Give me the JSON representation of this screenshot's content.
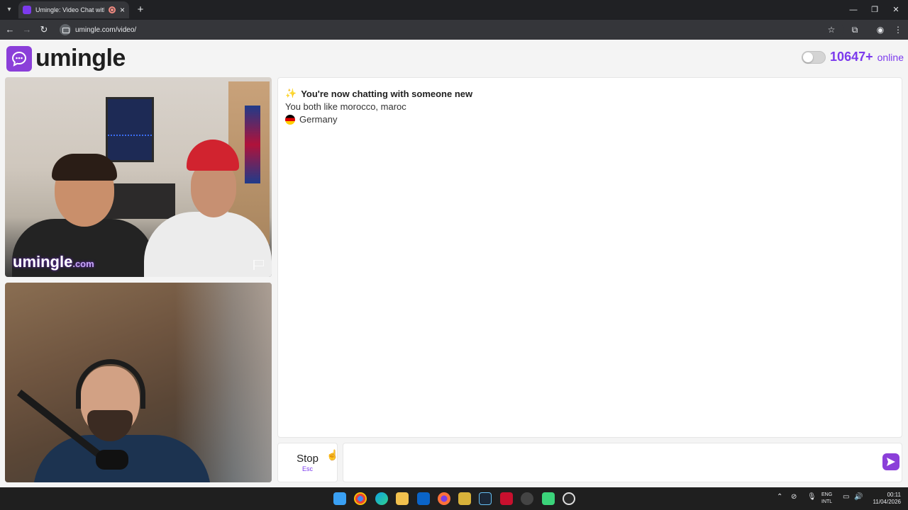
{
  "browser": {
    "tab_title": "Umingle: Video Chat with S",
    "url": "umingle.com/video/",
    "tab_list_icon": "chevron-down-icon",
    "new_tab_glyph": "+",
    "close_glyph": "×"
  },
  "header": {
    "logo_text": "umingle",
    "online_count": "10647+",
    "online_label": "online",
    "theme_toggle_on": false
  },
  "video": {
    "watermark": "umingle",
    "watermark_suffix": ".com"
  },
  "chat": {
    "title": "You're now chatting with someone new",
    "shared_interests": "You both like morocco, maroc",
    "country": "Germany"
  },
  "controls": {
    "stop_label": "Stop",
    "stop_shortcut": "Esc",
    "message_placeholder": ""
  },
  "taskbar": {
    "lang_line1": "ENG",
    "lang_line2": "INTL",
    "time": "00:11",
    "date": "11/04/2026"
  },
  "colors": {
    "brand": "#8b3fd9",
    "accent": "#7c3aed"
  }
}
